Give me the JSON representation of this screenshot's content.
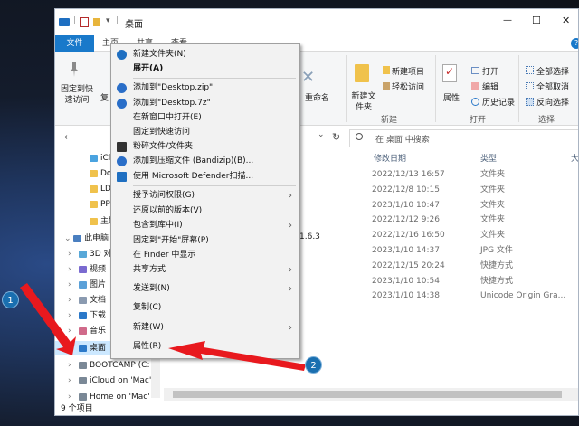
{
  "window": {
    "title": "桌面",
    "quick_access_sep": "|",
    "minimize": "—",
    "maximize": "☐",
    "close": "✕",
    "help": "?"
  },
  "ribbon_tabs": {
    "file": "文件",
    "home": "主页",
    "share": "共享",
    "view": "查看"
  },
  "ribbon": {
    "pin_label": "固定到快速访问",
    "copy_label": "复",
    "rename_label": "重命名",
    "new_folder_label": "新建文件夹",
    "new_item": "新建项目",
    "easy_access": "轻松访问",
    "new_group": "新建",
    "properties_label": "属性",
    "open": "打开",
    "edit": "编辑",
    "history": "历史记录",
    "open_group": "打开",
    "select_all": "全部选择",
    "select_none": "全部取消",
    "invert": "反向选择",
    "select_group": "选择",
    "dropdown": "▾"
  },
  "address": {
    "back": "←",
    "search_placeholder": "在 桌面 中搜索",
    "refresh": "↻",
    "dropdown": "⌄"
  },
  "columns": {
    "date": "修改日期",
    "type": "类型",
    "size": "大"
  },
  "nav": {
    "items": [
      {
        "label": "iCloud",
        "icon": "cloud-icon"
      },
      {
        "label": "Down",
        "icon": "folder-icon"
      },
      {
        "label": "LDA主",
        "icon": "folder-icon"
      },
      {
        "label": "PPT C",
        "icon": "folder-icon"
      },
      {
        "label": "主题一",
        "icon": "folder-icon"
      },
      {
        "label": "此电脑",
        "icon": "pc-icon"
      },
      {
        "label": "3D 对",
        "icon": "3d-icon"
      },
      {
        "label": "视频",
        "icon": "video-icon"
      },
      {
        "label": "图片",
        "icon": "picture-icon"
      },
      {
        "label": "文档",
        "icon": "doc-icon"
      },
      {
        "label": "下载",
        "icon": "download-icon"
      },
      {
        "label": "音乐",
        "icon": "music-icon"
      },
      {
        "label": "桌面",
        "icon": "desktop-icon"
      },
      {
        "label": "BOOTCAMP (C:",
        "icon": "drive-icon"
      },
      {
        "label": "iCloud on 'Mac'",
        "icon": "drive-icon"
      },
      {
        "label": "Home on 'Mac'",
        "icon": "drive-icon"
      }
    ]
  },
  "files": [
    {
      "date": "2022/12/13 16:57",
      "type": "文件夹"
    },
    {
      "date": "2022/12/8 10:15",
      "type": "文件夹"
    },
    {
      "date": "2023/1/10 10:47",
      "type": "文件夹"
    },
    {
      "date": "2022/12/12 9:26",
      "type": "文件夹"
    },
    {
      "date": "2022/12/16 16:50",
      "type": "文件夹"
    },
    {
      "date": "2023/1/10 14:37",
      "type": "JPG 文件"
    },
    {
      "date": "2022/12/15 20:24",
      "type": "快捷方式"
    },
    {
      "date": "2023/1/10 10:54",
      "type": "快捷方式"
    },
    {
      "date": "2023/1/10 14:38",
      "type": "Unicode Origin Gra..."
    }
  ],
  "partial_name": "1.6.3",
  "status": {
    "count": "9 个项目"
  },
  "context_menu": {
    "items": [
      {
        "label": "新建文件夹(N)",
        "icon": "new-folder-icon",
        "bold": false
      },
      {
        "label": "展开(A)",
        "icon": "",
        "bold": true
      },
      {
        "label": "添加到\"Desktop.zip\"",
        "icon": "bandizip-icon"
      },
      {
        "label": "添加到\"Desktop.7z\"",
        "icon": "bandizip-icon"
      },
      {
        "label": "在新窗口中打开(E)",
        "icon": ""
      },
      {
        "label": "固定到快速访问",
        "icon": ""
      },
      {
        "label": "粉碎文件/文件夹",
        "icon": "shredder-icon"
      },
      {
        "label": "添加到压缩文件 (Bandizip)(B)...",
        "icon": "bandizip-icon"
      },
      {
        "label": "使用 Microsoft Defender扫描...",
        "icon": "defender-icon"
      },
      {
        "label": "授予访问权限(G)",
        "icon": "",
        "submenu": true
      },
      {
        "label": "还原以前的版本(V)",
        "icon": ""
      },
      {
        "label": "包含到库中(I)",
        "icon": "",
        "submenu": true
      },
      {
        "label": "固定到\"开始\"屏幕(P)",
        "icon": ""
      },
      {
        "label": "在 Finder 中显示",
        "icon": ""
      },
      {
        "label": "共享方式",
        "icon": "",
        "submenu": true
      },
      {
        "label": "发送到(N)",
        "icon": "",
        "submenu": true
      },
      {
        "label": "复制(C)",
        "icon": ""
      },
      {
        "label": "新建(W)",
        "icon": "",
        "submenu": true
      },
      {
        "label": "属性(R)",
        "icon": ""
      }
    ],
    "submenu_arrow": "›"
  },
  "annotations": {
    "badge1": "1",
    "badge2": "2",
    "arrow_color": "#e8191e"
  }
}
